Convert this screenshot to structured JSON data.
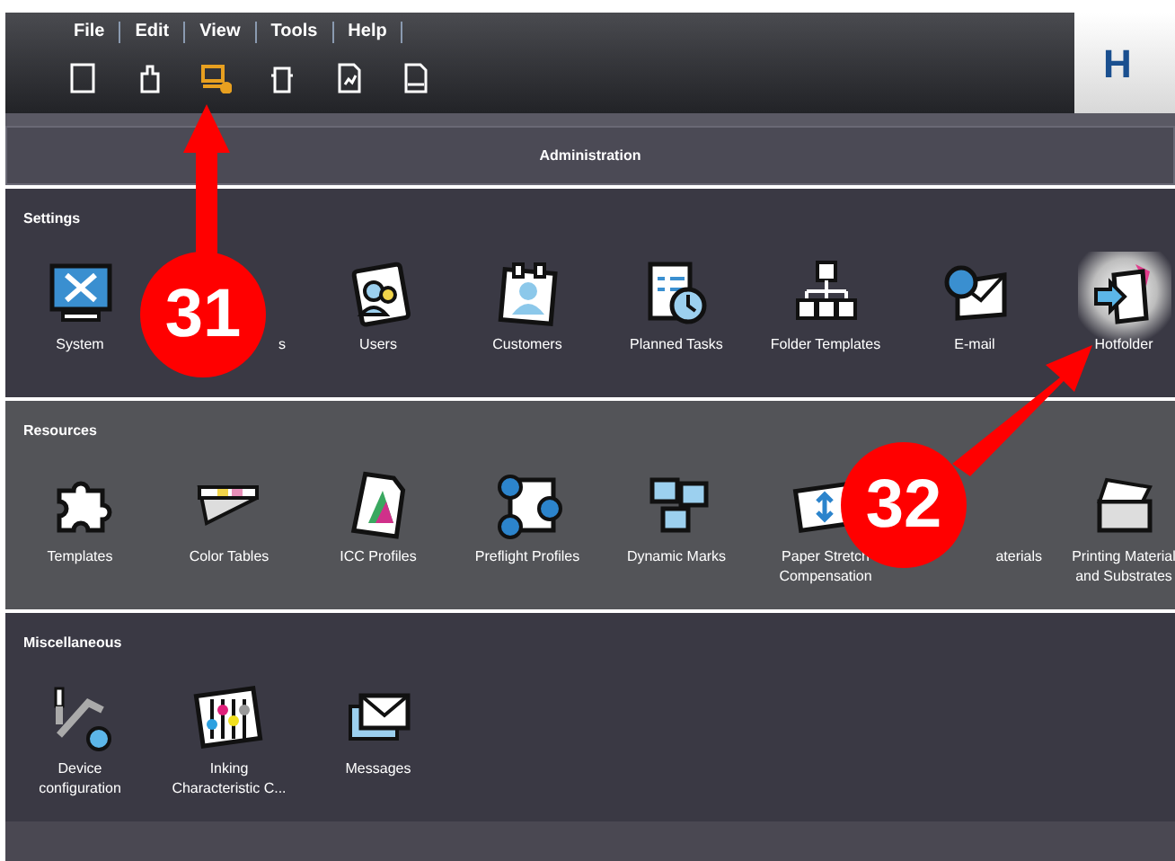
{
  "menu": [
    {
      "label": "File"
    },
    {
      "label": "Edit"
    },
    {
      "label": "View"
    },
    {
      "label": "Tools"
    },
    {
      "label": "Help"
    }
  ],
  "toolbar": [
    {
      "selected": false
    },
    {
      "selected": false
    },
    {
      "selected": true
    },
    {
      "selected": false
    },
    {
      "selected": false
    },
    {
      "selected": false
    }
  ],
  "logo": {
    "text": "H"
  },
  "title": "Administration",
  "sections": [
    {
      "title": "Settings",
      "items": [
        {
          "label": "System",
          "selected": false
        },
        {
          "label": "s",
          "selected": false,
          "covered_start": true
        },
        {
          "label": "Users",
          "selected": false
        },
        {
          "label": "Customers",
          "selected": false
        },
        {
          "label": "Planned Tasks",
          "selected": false
        },
        {
          "label": "Folder Templates",
          "selected": false
        },
        {
          "label": "E-mail",
          "selected": false
        },
        {
          "label": "Hotfolder",
          "selected": true
        }
      ]
    },
    {
      "title": "Resources",
      "items": [
        {
          "label": "Templates",
          "selected": false
        },
        {
          "label": "Color Tables",
          "selected": false
        },
        {
          "label": "ICC Profiles",
          "selected": false
        },
        {
          "label": "Preflight Profiles",
          "selected": false
        },
        {
          "label": "Dynamic Marks",
          "selected": false
        },
        {
          "label": "Paper Stretch\nCompensation",
          "selected": false
        },
        {
          "label": "aterials",
          "selected": false,
          "covered_start": true
        },
        {
          "label": "Printing Material\nand Substrates",
          "selected": false
        }
      ]
    },
    {
      "title": "Miscellaneous",
      "items": [
        {
          "label": "Device\nconfiguration",
          "selected": false
        },
        {
          "label": "Inking\nCharacteristic C...",
          "selected": false
        },
        {
          "label": "Messages",
          "selected": false
        }
      ]
    }
  ],
  "callouts": [
    {
      "label": "31"
    },
    {
      "label": "32"
    }
  ]
}
